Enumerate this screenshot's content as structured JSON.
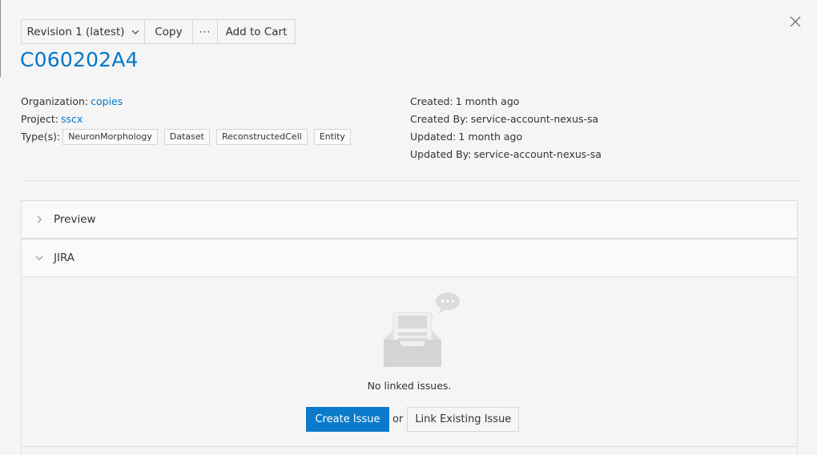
{
  "toolbar": {
    "revision_label": "Revision 1 (latest)",
    "copy_label": "Copy",
    "more_label": "···",
    "cart_label": "Add to Cart"
  },
  "resource": {
    "title": "C060202A4"
  },
  "meta": {
    "organization_label": "Organization:",
    "organization_value": "copies",
    "project_label": "Project:",
    "project_value": "sscx",
    "types_label": "Type(s):",
    "types": [
      "NeuronMorphology",
      "Dataset",
      "ReconstructedCell",
      "Entity"
    ],
    "created_label": "Created:",
    "created_value": "1 month ago",
    "created_by_label": "Created By:",
    "created_by_value": "service-account-nexus-sa",
    "updated_label": "Updated:",
    "updated_value": "1 month ago",
    "updated_by_label": "Updated By:",
    "updated_by_value": "service-account-nexus-sa"
  },
  "panels": {
    "preview_label": "Preview",
    "jira_label": "JIRA"
  },
  "jira": {
    "empty_text": "No linked issues.",
    "create_label": "Create Issue",
    "or_label": "or",
    "link_label": "Link Existing Issue"
  },
  "colors": {
    "accent": "#0077cc",
    "primary_button": "#0a7bcc",
    "background": "#f5f5f5"
  }
}
